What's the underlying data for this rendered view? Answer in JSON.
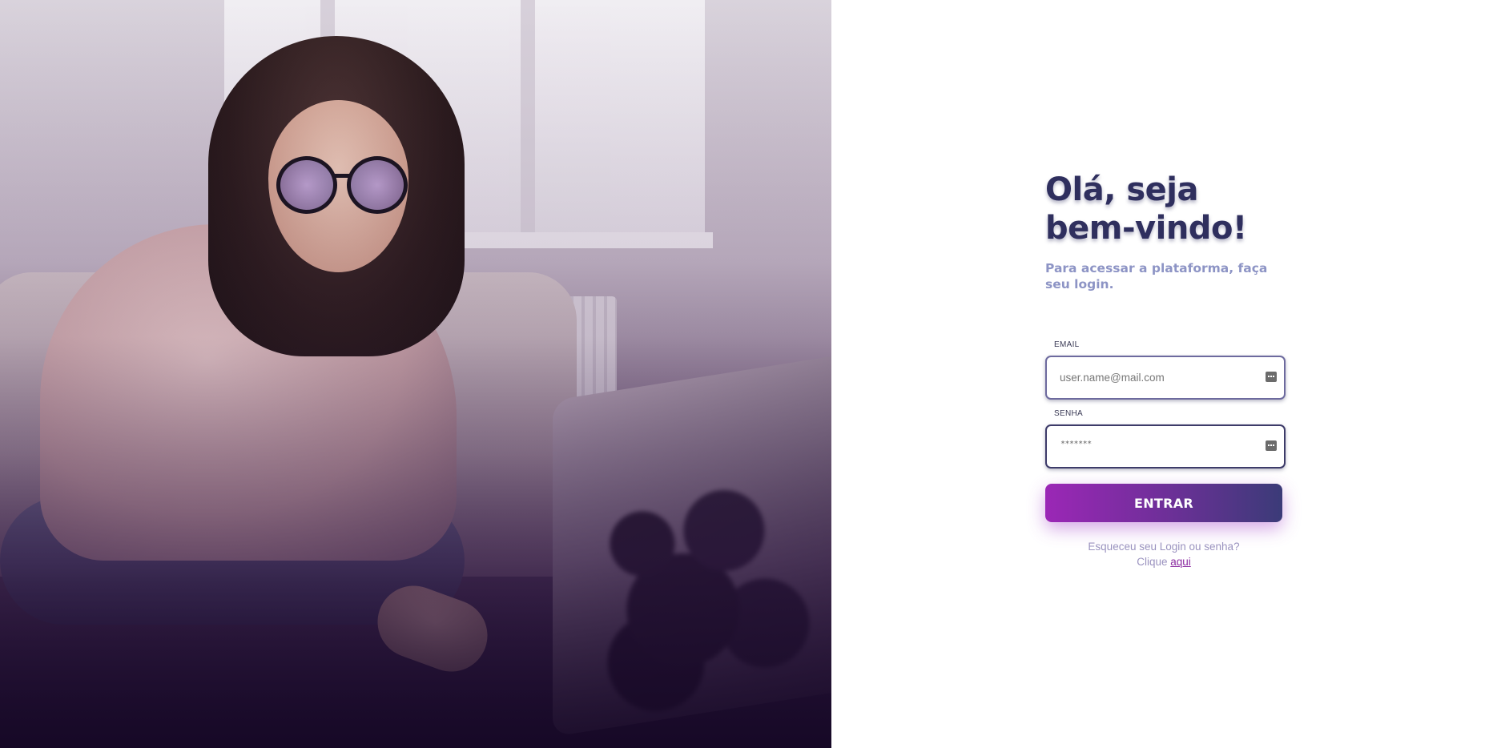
{
  "login": {
    "title_line1": "Olá, seja",
    "title_line2": "bem-vindo!",
    "subtitle": "Para acessar a plataforma, faça seu login.",
    "email": {
      "label": "EMAIL",
      "placeholder": "user.name@mail.com",
      "value": ""
    },
    "password": {
      "label": "SENHA",
      "masked_value": "*******"
    },
    "submit_label": "ENTRAR",
    "forgot_line1": "Esqueceu seu Login ou senha?",
    "forgot_prefix": "Clique",
    "forgot_link": "aqui"
  },
  "colors": {
    "title": "#2f2f5e",
    "subtitle": "#8d94c5",
    "button_start": "#9b27b6",
    "button_end": "#3b3b78",
    "link": "#8a2aa0"
  },
  "icons": {
    "email_field_icon": "password-manager-key-icon",
    "password_field_icon": "password-manager-key-icon"
  }
}
